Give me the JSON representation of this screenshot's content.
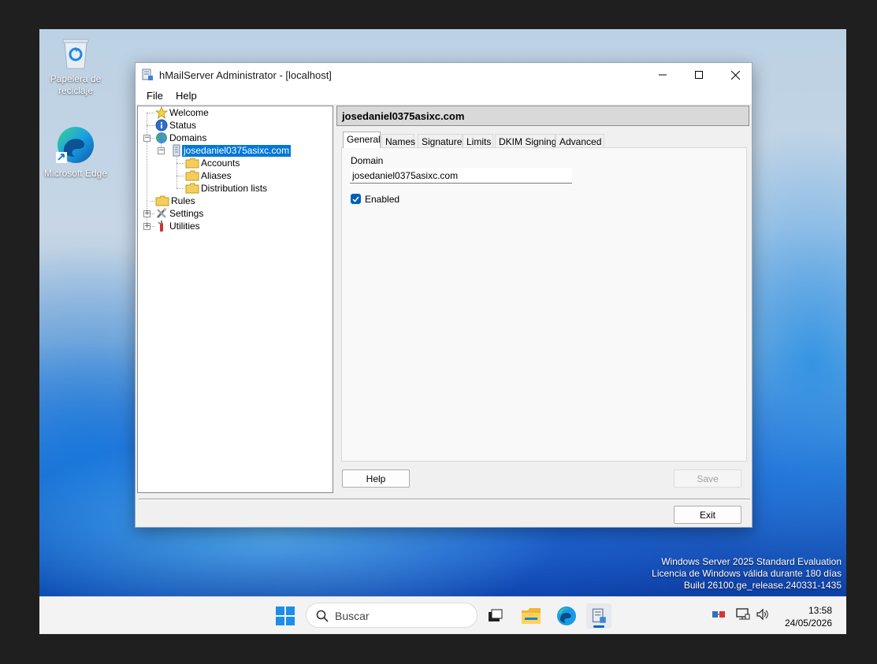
{
  "desktop": {
    "icons": [
      {
        "label": "Papelera de reciclaje",
        "icon": "recycle-bin-icon"
      },
      {
        "label": "Microsoft Edge",
        "icon": "edge-icon"
      }
    ],
    "watermark": {
      "line1": "Windows Server 2025 Standard Evaluation",
      "line2": "Licencia de Windows válida durante 180 días",
      "line3": "Build 26100.ge_release.240331-1435"
    }
  },
  "window": {
    "title": "hMailServer Administrator - [localhost]",
    "menu": [
      "File",
      "Help"
    ],
    "tree": {
      "welcome": "Welcome",
      "status": "Status",
      "domains": "Domains",
      "domain_item": "josedaniel0375asixc.com",
      "accounts": "Accounts",
      "aliases": "Aliases",
      "distribution_lists": "Distribution lists",
      "rules": "Rules",
      "settings": "Settings",
      "utilities": "Utilities"
    },
    "header": "josedaniel0375asixc.com",
    "tabs": [
      "General",
      "Names",
      "Signature",
      "Limits",
      "DKIM Signing",
      "Advanced"
    ],
    "active_tab": "General",
    "general": {
      "domain_label": "Domain",
      "domain_value": "josedaniel0375asixc.com",
      "enabled_label": "Enabled",
      "enabled": true
    },
    "buttons": {
      "help": "Help",
      "save": "Save",
      "exit": "Exit"
    }
  },
  "taskbar": {
    "search_placeholder": "Buscar",
    "time": "13:58",
    "date": "24/05/2026"
  },
  "colors": {
    "selection": "#0078d7",
    "checkbox": "#005fb8"
  }
}
